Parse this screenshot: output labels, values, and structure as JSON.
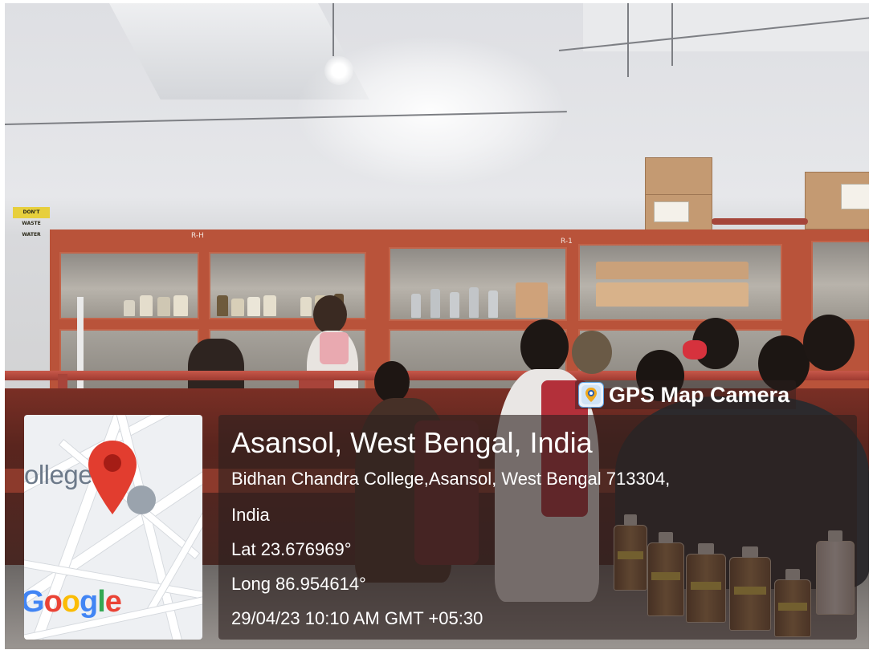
{
  "photo": {
    "subject": "chemistry laboratory with teacher and students",
    "wall_sign": "DON'T WASTE WATER",
    "cabinet_tags": [
      "R-H",
      "R-1"
    ]
  },
  "overlay": {
    "brand": "GPS Map Camera",
    "brand_icon": "map-pin-camera-icon",
    "title": "Asansol, West Bengal, India",
    "address_line1": "Bidhan Chandra College,Asansol, West Bengal 713304,",
    "address_line2": "India",
    "lat": "Lat 23.676969°",
    "long": "Long 86.954614°",
    "datetime": "29/04/23 10:10 AM GMT +05:30"
  },
  "map": {
    "label": "ollege",
    "google": "Google",
    "pin_icon": "location-pin-icon",
    "pin_color": "#e23d2f",
    "google_colors": [
      "#4285f4",
      "#ea4335",
      "#fbbc05",
      "#4285f4",
      "#34a853",
      "#ea4335"
    ]
  },
  "colors": {
    "panel_bg": "#2d201e",
    "cabinet": "#b9533a",
    "rail": "#c7584a"
  }
}
